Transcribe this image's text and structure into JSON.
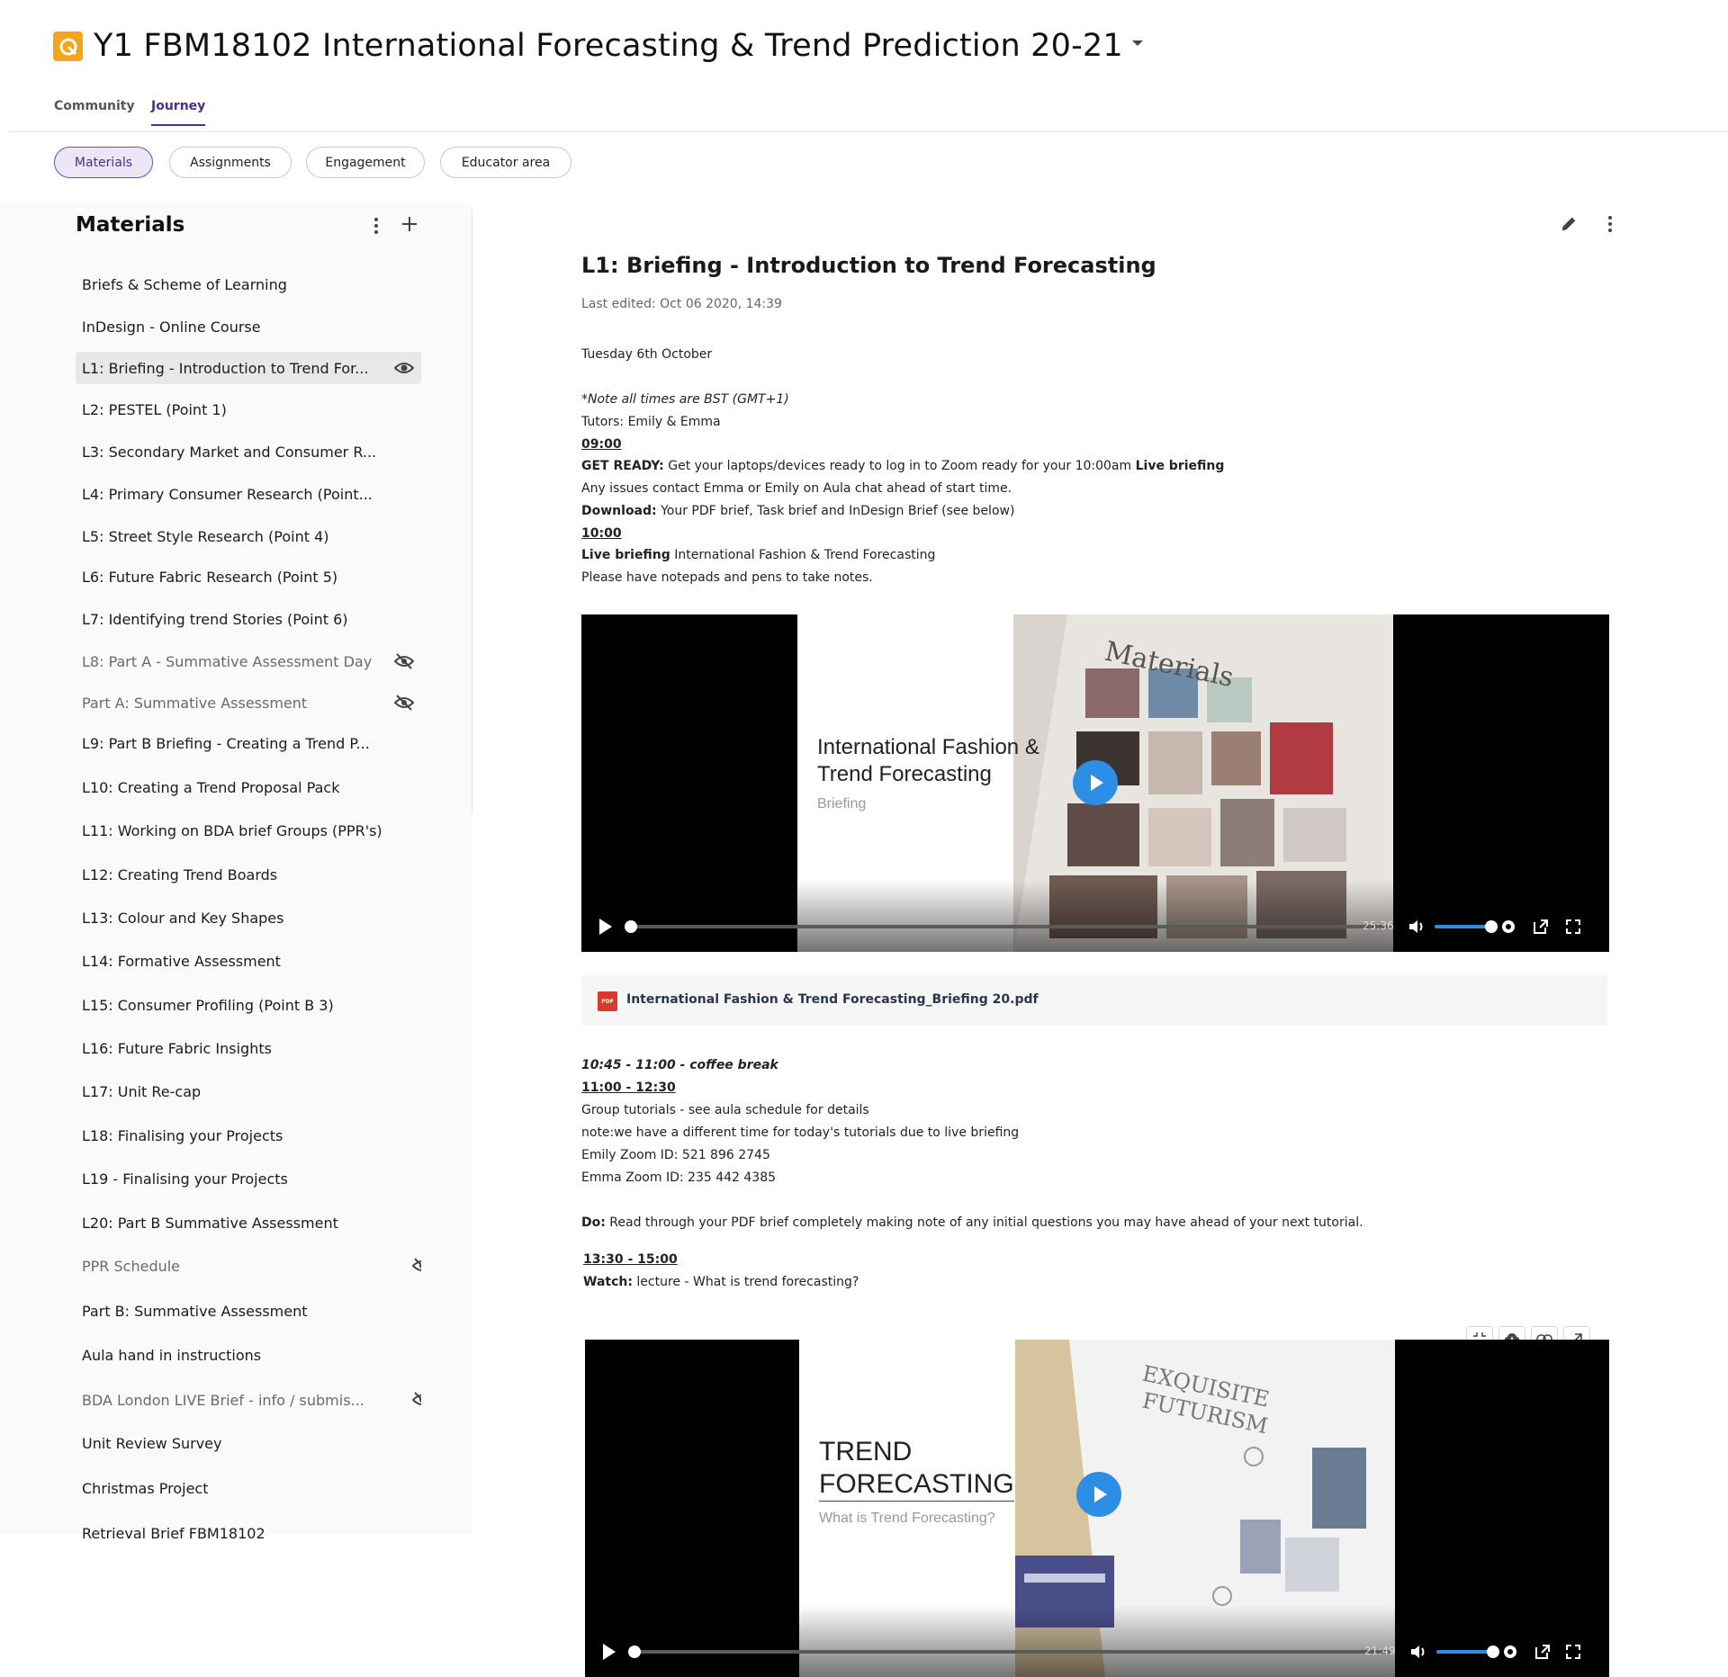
{
  "header": {
    "title": "Y1 FBM18102 International Forecasting & Trend Prediction 20-21",
    "logo_icon": "brand-logo-icon",
    "accent": "#f5a51c"
  },
  "top_tabs": [
    {
      "label": "Community",
      "active": false
    },
    {
      "label": "Journey",
      "active": true
    }
  ],
  "pills": [
    {
      "label": "Materials",
      "active": true
    },
    {
      "label": "Assignments",
      "active": false
    },
    {
      "label": "Engagement",
      "active": false
    },
    {
      "label": "Educator area",
      "active": false
    }
  ],
  "sidebar": {
    "heading": "Materials",
    "items": [
      {
        "label": "Briefs & Scheme of Learning"
      },
      {
        "label": "InDesign - Online Course"
      },
      {
        "label": "L1: Briefing - Introduction to Trend For...",
        "active": true,
        "icon": "eye-icon"
      },
      {
        "label": "L2: PESTEL (Point 1)"
      },
      {
        "label": "L3: Secondary Market and Consumer R..."
      },
      {
        "label": "L4: Primary Consumer Research (Point..."
      },
      {
        "label": "L5: Street Style Research (Point 4)"
      },
      {
        "label": "L6: Future Fabric Research (Point 5)"
      },
      {
        "label": "L7: Identifying trend Stories (Point 6)"
      },
      {
        "label": "L8: Part A - Summative Assessment Day",
        "hidden": true,
        "icon": "eye-off-icon"
      },
      {
        "label": "Part A: Summative Assessment",
        "hidden": true,
        "icon": "eye-off-icon"
      },
      {
        "label": "L9: Part B Briefing - Creating a Trend P..."
      },
      {
        "label": "L10: Creating a Trend Proposal Pack"
      },
      {
        "label": "L11: Working on BDA brief Groups (PPR's)"
      },
      {
        "label": "L12: Creating Trend Boards"
      },
      {
        "label": "L13: Colour and Key Shapes"
      },
      {
        "label": "L14: Formative Assessment"
      },
      {
        "label": "L15: Consumer Profiling (Point B 3)"
      },
      {
        "label": "L16: Future Fabric Insights"
      },
      {
        "label": "L17: Unit Re-cap"
      },
      {
        "label": "L18: Finalising your Projects"
      },
      {
        "label": "L19 - Finalising your Projects"
      },
      {
        "label": "L20: Part B Summative Assessment"
      },
      {
        "label": "PPR Schedule",
        "hidden": true,
        "icon": "eye-off-icon"
      },
      {
        "label": "Part B: Summative Assessment"
      },
      {
        "label": "Aula hand in instructions"
      },
      {
        "label": "BDA London LIVE Brief - info / submis...",
        "hidden": true,
        "icon": "eye-off-icon"
      },
      {
        "label": "Unit Review Survey"
      },
      {
        "label": "Christmas Project"
      },
      {
        "label": "Retrieval Brief FBM18102"
      }
    ]
  },
  "main": {
    "title": "L1: Briefing - Introduction to Trend Forecasting",
    "last_edited": "Last edited: Oct 06 2020, 14:39",
    "date": "Tuesday 6th October",
    "note": "*Note all times are BST (GMT+1)",
    "tutors": "Tutors: Emily & Emma",
    "t1": "09:00",
    "get_ready_label": "GET READY:",
    "get_ready_text": " Get your laptops/devices ready to log in to Zoom ready for your 10:00am ",
    "get_ready_bold": "Live briefing",
    "issues": "Any issues contact Emma or Emily on Aula chat ahead of start time.",
    "download_label": "Download:",
    "download_text": " Your PDF brief, Task brief and InDesign Brief (see below)",
    "t2": "10:00",
    "live_label": "Live briefing",
    "live_text": " International Fashion & Trend Forecasting",
    "notepads": "Please have notepads and pens to take notes.",
    "video1": {
      "slide_title_1": "International Fashion &",
      "slide_title_2": "Trend Forecasting",
      "slide_sub": "Briefing",
      "overlay_word": "Materials",
      "duration": "25:36",
      "progress": 0,
      "volume": 0.9
    },
    "pdf_name": "International Fashion & Trend Forecasting_Briefing 20.pdf",
    "pdf_badge": "PDF",
    "coffee": "10:45 - 11:00 - coffee break",
    "t3": "11:00 - 12:30",
    "group": "Group tutorials - see aula schedule for details",
    "note2": "note:we have a different time for today's tutorials due to live briefing",
    "emily_zoom": "Emily Zoom ID: 521 896 2745",
    "emma_zoom": "Emma Zoom ID: 235 442 4385",
    "do_label": "Do:",
    "do_text": " Read through your PDF brief completely making note of any initial questions you may have ahead of your next tutorial.",
    "t4": "13:30 - 15:00",
    "watch_label": "Watch:",
    "watch_text": " lecture - What is trend forecasting?",
    "video2": {
      "slide_title_1": "TREND",
      "slide_title_2": "FORECASTING",
      "slide_sub": "What is Trend Forecasting?",
      "overlay_word_1": "EXQUISITE",
      "overlay_word_2": "FUTURISM",
      "duration": "21:49",
      "progress": 0,
      "volume": 0.9
    }
  },
  "colors": {
    "accent_purple": "#4a2f8f",
    "play_blue": "#2d8ee6",
    "pdf_red": "#d93a2b"
  }
}
